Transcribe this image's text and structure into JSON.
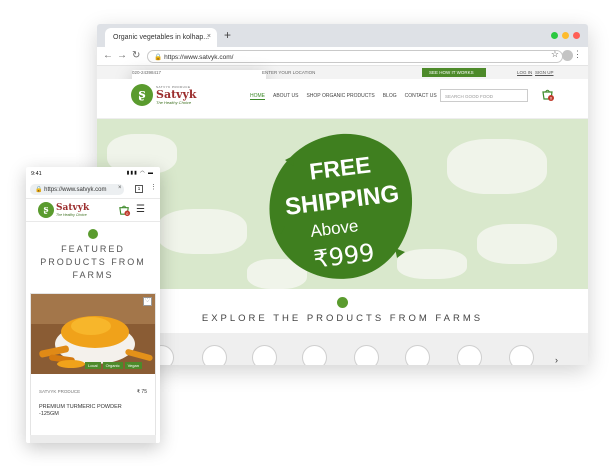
{
  "desktop": {
    "tab_title": "Organic vegetables in kolhap...",
    "tab_close": "×",
    "new_tab": "+",
    "url": "https://www.satvyk.com/",
    "top_strip": {
      "phone": "020-24398417",
      "location": "ENTER YOUR LOCATION",
      "how_it_works": "SEE HOW IT WORKS",
      "login": "LOG IN",
      "signup": "SIGN UP"
    },
    "logo": {
      "small": "SATVYK PRODUCE",
      "word": "Satvyk",
      "tagline": "The Healthy Choice"
    },
    "menu": [
      "HOME",
      "ABOUT US",
      "SHOP ORGANIC PRODUCTS",
      "BLOG",
      "CONTACT US"
    ],
    "search_placeholder": "SEARCH GOOD FOOD",
    "cart_count": "0",
    "hero": {
      "line1": "FREE",
      "line2": "SHIPPING",
      "line3": "Above",
      "line4": "₹999"
    },
    "explore_title": "EXPLORE THE PRODUCTS FROM FARMS",
    "next_arrow": "›",
    "colors": {
      "green": "#4d8a2a",
      "hero_bg": "#d9e8cc",
      "brand_red": "#9b2d2d"
    }
  },
  "mobile": {
    "time": "9:41",
    "signal": "▮▮▮ ◠ ▬",
    "url": "https://www.satvyk.com",
    "url_close": "×",
    "tab_count": "1",
    "kebab": "⋮",
    "cart_count": "0",
    "menu_icon": "☰",
    "featured_title": [
      "FEATURED",
      "PRODUCTS FROM",
      "FARMS"
    ],
    "product": {
      "tags": [
        "Local",
        "Organic",
        "Vegan"
      ],
      "brand": "SATVYK PRODUCE",
      "price": "₹ 75",
      "name": "PREMIUM TURMERIC POWDER -125GM"
    }
  }
}
